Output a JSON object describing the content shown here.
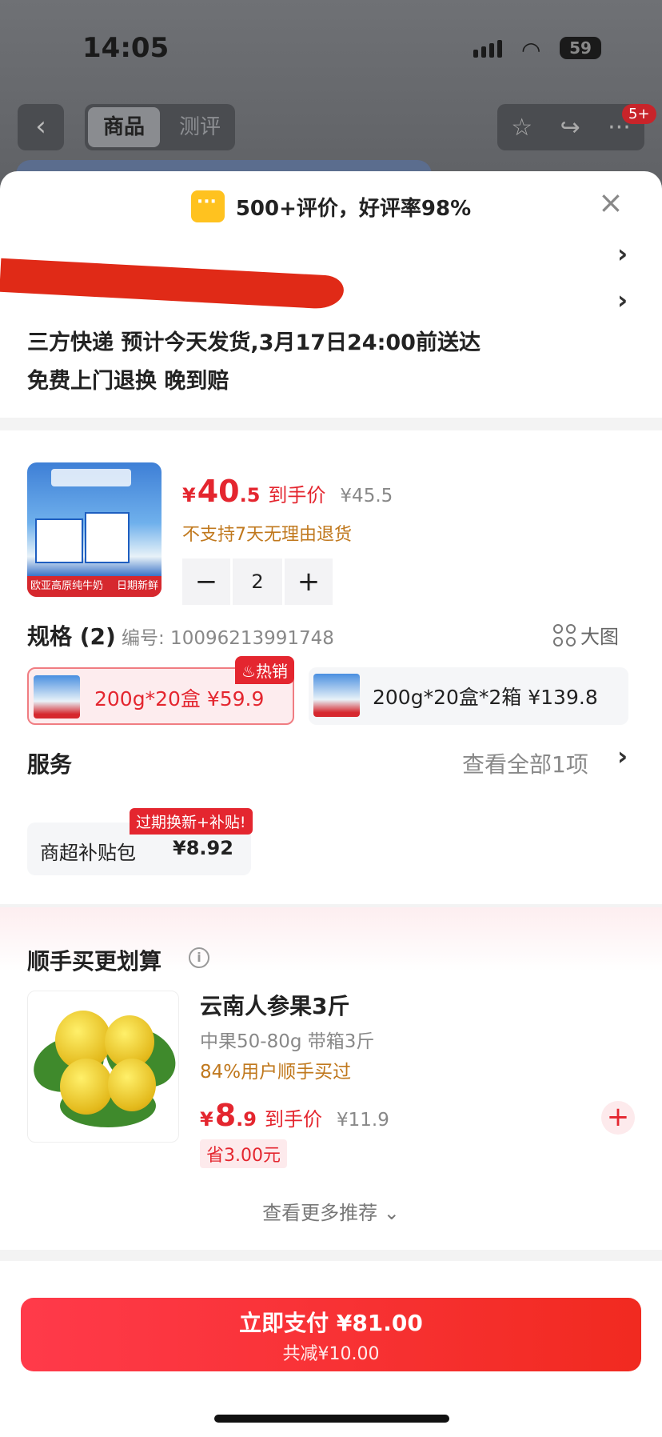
{
  "status_bar": {
    "time": "14:05",
    "battery": "59"
  },
  "nav": {
    "tab_active": "商品",
    "tab_inactive": "测评",
    "badge": "5+"
  },
  "sheet": {
    "rating": "500+评价，好评率98%",
    "close": "×",
    "shipping": "三方快递 预计今天发货,3月17日24:00前送达",
    "returns": "免费上门退换  晚到赔"
  },
  "product": {
    "img_label_left": "欧亚高原纯牛奶",
    "img_label_right": "日期新鲜",
    "price_symbol": "¥",
    "price_int": "40",
    "price_dec": ".5",
    "price_tag": "到手价",
    "original_price": "¥45.5",
    "return_policy": "不支持7天无理由退货",
    "qty_minus": "−",
    "quantity": "2",
    "qty_plus": "+"
  },
  "spec": {
    "title": "规格 (2)",
    "code": "编号: 10096213991748",
    "big_image": "大图",
    "hot_badge": "热销",
    "options": [
      {
        "label": "200g*20盒   ¥59.9",
        "selected": true
      },
      {
        "label": "200g*20盒*2箱   ¥139.8",
        "selected": false
      }
    ]
  },
  "service": {
    "title": "服务",
    "view_all": "查看全部1项",
    "badge": "过期换新+补贴!",
    "item_name": "商超补贴包",
    "item_price": "¥8.92"
  },
  "bundle": {
    "title": "顺手买更划算",
    "item_name": "云南人参果3斤",
    "item_spec": "中果50-80g 带箱3斤",
    "buyers": "84%用户顺手买过",
    "price_symbol": "¥",
    "price_int": "8",
    "price_dec": ".9",
    "price_tag": "到手价",
    "original_price": "¥11.9",
    "save": "省3.00元",
    "add": "+",
    "more": "查看更多推荐 ⌄"
  },
  "pay": {
    "main": "立即支付 ¥81.00",
    "sub": "共减¥10.00"
  },
  "colors": {
    "accent": "#e4262f",
    "warning": "#c0781d"
  }
}
